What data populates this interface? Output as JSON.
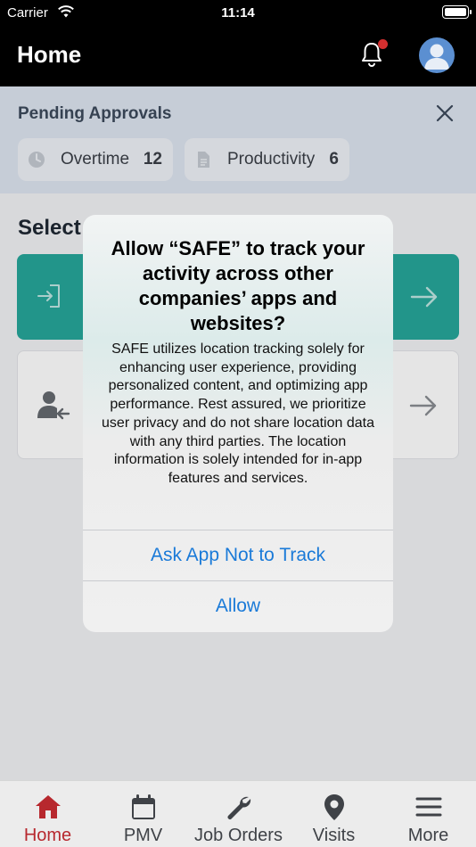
{
  "status_bar": {
    "carrier": "Carrier",
    "time": "11:14"
  },
  "header": {
    "title": "Home"
  },
  "pending": {
    "title": "Pending Approvals",
    "chips": [
      {
        "label": "Overtime",
        "count": "12"
      },
      {
        "label": "Productivity",
        "count": "6"
      }
    ]
  },
  "select": {
    "title": "Select"
  },
  "alert": {
    "title": "Allow “SAFE” to track your activity across other companies’ apps and websites?",
    "message": "SAFE utilizes location tracking solely for enhancing user experience, providing personalized content, and optimizing app performance. Rest assured, we prioritize user privacy and do not share location data with any third parties. The location information is solely intended for in-app features and services.",
    "ask_not_track": "Ask App Not to Track",
    "allow": "Allow"
  },
  "tabs": [
    {
      "label": "Home",
      "icon": "home-icon",
      "active": true
    },
    {
      "label": "PMV",
      "icon": "calendar-icon"
    },
    {
      "label": "Job Orders",
      "icon": "wrench-icon"
    },
    {
      "label": "Visits",
      "icon": "map-pin-icon"
    },
    {
      "label": "More",
      "icon": "menu-icon"
    }
  ],
  "colors": {
    "accent": "#b7282e",
    "teal": "#26a69a",
    "link": "#1a7ad8",
    "notification_dot": "#d32f2f"
  }
}
